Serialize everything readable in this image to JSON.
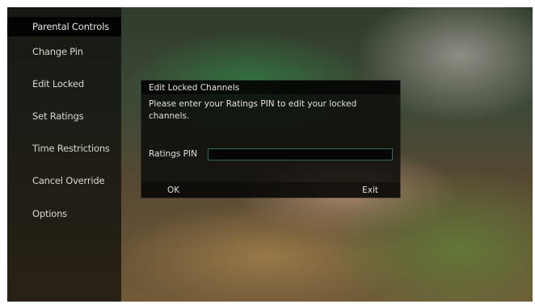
{
  "menu": {
    "title": "Parental Controls",
    "items": [
      {
        "label": "Change Pin"
      },
      {
        "label": "Edit Locked"
      },
      {
        "label": "Set Ratings"
      },
      {
        "label": "Time Restrictions"
      },
      {
        "label": "Cancel Override"
      },
      {
        "label": "Options"
      }
    ]
  },
  "dialog": {
    "title": "Edit Locked Channels",
    "message": "Please enter your Ratings PIN to edit your locked channels.",
    "pin_label": "Ratings PIN",
    "pin_value": "",
    "ok_label": "OK",
    "exit_label": "Exit"
  }
}
